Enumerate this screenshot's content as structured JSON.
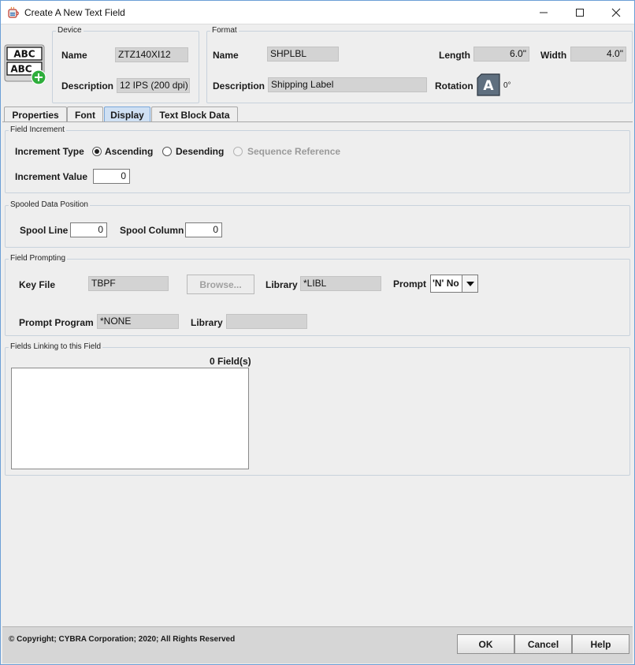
{
  "window": {
    "title": "Create A New Text Field",
    "icon": "java-cup-icon"
  },
  "device": {
    "group_title": "Device",
    "name_label": "Name",
    "name_value": "ZTZ140XI12",
    "description_label": "Description",
    "description_value": "12 IPS (200 dpi)",
    "icon_text_top": "ABC",
    "icon_text_bottom": "ABC"
  },
  "format": {
    "group_title": "Format",
    "name_label": "Name",
    "name_value": "SHPLBL",
    "description_label": "Description",
    "description_value": "Shipping Label",
    "length_label": "Length",
    "length_value": "6.0\"",
    "width_label": "Width",
    "width_value": "4.0\"",
    "rotation_label": "Rotation",
    "rotation_glyph": "A",
    "rotation_value": "0°"
  },
  "tabs": [
    {
      "label": "Properties",
      "active": false
    },
    {
      "label": "Font",
      "active": false
    },
    {
      "label": "Display",
      "active": true
    },
    {
      "label": "Text Block Data",
      "active": false
    }
  ],
  "field_increment": {
    "group_title": "Field Increment",
    "type_label": "Increment Type",
    "options": [
      {
        "label": "Ascending",
        "checked": true,
        "enabled": true
      },
      {
        "label": "Desending",
        "checked": false,
        "enabled": true
      },
      {
        "label": "Sequence Reference",
        "checked": false,
        "enabled": false
      }
    ],
    "value_label": "Increment Value",
    "value": "0"
  },
  "spooled": {
    "group_title": "Spooled Data Position",
    "line_label": "Spool Line",
    "line_value": "0",
    "column_label": "Spool Column",
    "column_value": "0"
  },
  "prompting": {
    "group_title": "Field Prompting",
    "key_file_label": "Key File",
    "key_file_value": "TBPF",
    "browse_label": "Browse...",
    "library_label": "Library",
    "library_value": "*LIBL",
    "prompt_label": "Prompt",
    "prompt_value": "'N' No",
    "program_label": "Prompt Program",
    "program_value": "*NONE",
    "program_library_label": "Library",
    "program_library_value": ""
  },
  "linking": {
    "group_title": "Fields Linking to this Field",
    "count_label": "0 Field(s)"
  },
  "footer": {
    "copyright": "© Copyright; CYBRA Corporation; 2020; All Rights Reserved",
    "ok_label": "OK",
    "cancel_label": "Cancel",
    "help_label": "Help"
  }
}
